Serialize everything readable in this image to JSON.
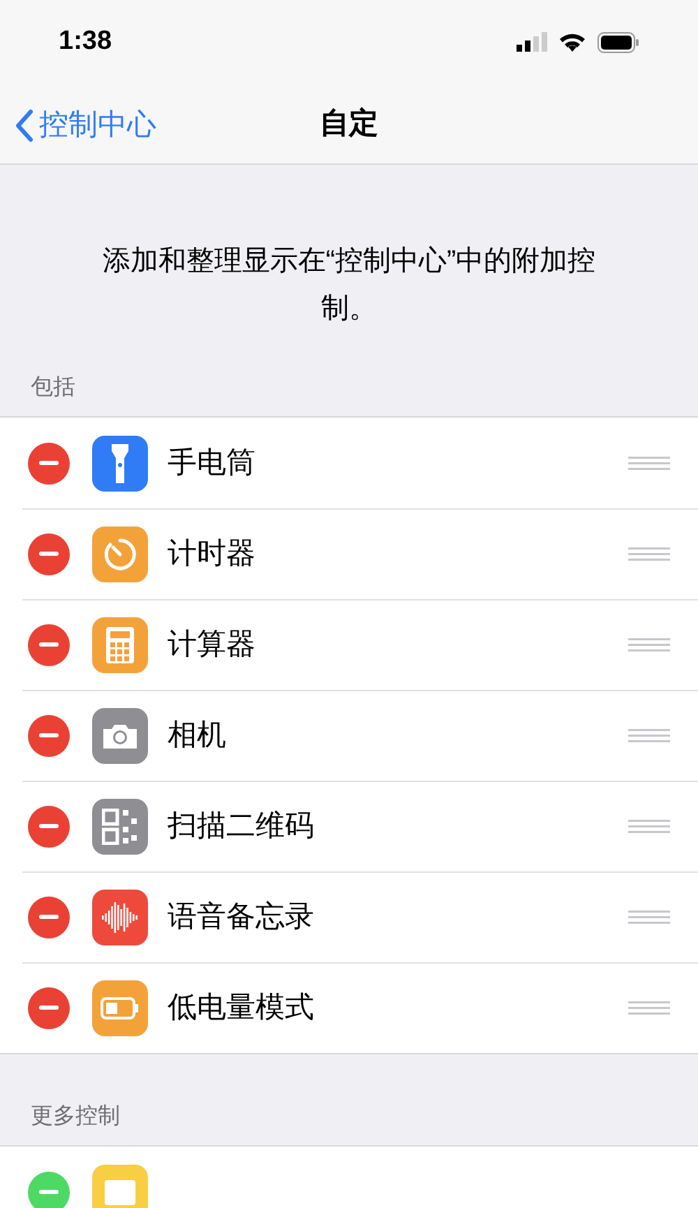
{
  "status_bar": {
    "time": "1:38"
  },
  "nav": {
    "back": "控制中心",
    "title": "自定"
  },
  "description": "添加和整理显示在“控制中心”中的附加控制。",
  "sections": [
    {
      "header": "包括",
      "kind": "remove",
      "items": [
        {
          "label": "手电筒",
          "kind": "flashlight",
          "color": "#2f7cf6"
        },
        {
          "label": "计时器",
          "kind": "timer",
          "color": "#f3a23a"
        },
        {
          "label": "计算器",
          "kind": "calculator",
          "color": "#f3a23a"
        },
        {
          "label": "相机",
          "kind": "camera",
          "color": "#8e8e93"
        },
        {
          "label": "扫描二维码",
          "kind": "qr",
          "color": "#8e8e93"
        },
        {
          "label": "语音备忘录",
          "kind": "voice",
          "color": "#ee4a3c"
        },
        {
          "label": "低电量模式",
          "kind": "battery",
          "color": "#f3a23a"
        }
      ]
    },
    {
      "header": "更多控制",
      "kind": "add",
      "items": [
        {
          "kind": "notes",
          "color": "#f8cf43"
        }
      ]
    }
  ]
}
